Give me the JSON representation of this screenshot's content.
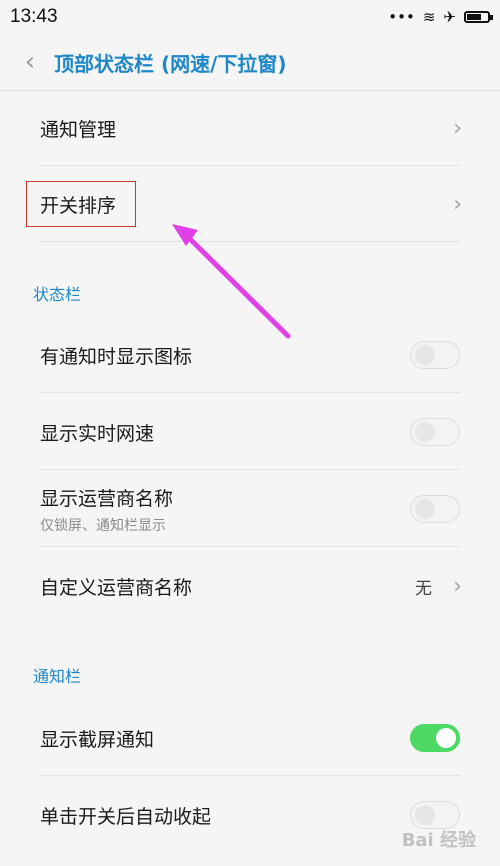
{
  "status_bar": {
    "time": "13:43",
    "dots": "•••",
    "wifi": "≋",
    "airplane": "✈",
    "battery_level": 0.7
  },
  "header": {
    "back_icon": "chevron-left-icon",
    "title": "顶部状态栏 (网速/下拉窗)"
  },
  "items": {
    "notification_mgmt": {
      "label": "通知管理"
    },
    "switch_order": {
      "label": "开关排序"
    }
  },
  "sections": {
    "status_bar": {
      "title": "状态栏",
      "items": [
        {
          "label": "有通知时显示图标",
          "on": false
        },
        {
          "label": "显示实时网速",
          "on": false
        },
        {
          "label": "显示运营商名称",
          "sublabel": "仅锁屏、通知栏显示",
          "on": false
        },
        {
          "label": "自定义运营商名称",
          "value": "无"
        }
      ]
    },
    "notification_bar": {
      "title": "通知栏",
      "items": [
        {
          "label": "显示截屏通知",
          "on": true
        },
        {
          "label": "单击开关后自动收起",
          "on": false
        }
      ]
    }
  },
  "watermark": "Bai 经验",
  "colors": {
    "accent": "#1e87c8",
    "toggle_on": "#4cd964",
    "highlight_box": "#c23a2e",
    "arrow": "#e040e6"
  }
}
